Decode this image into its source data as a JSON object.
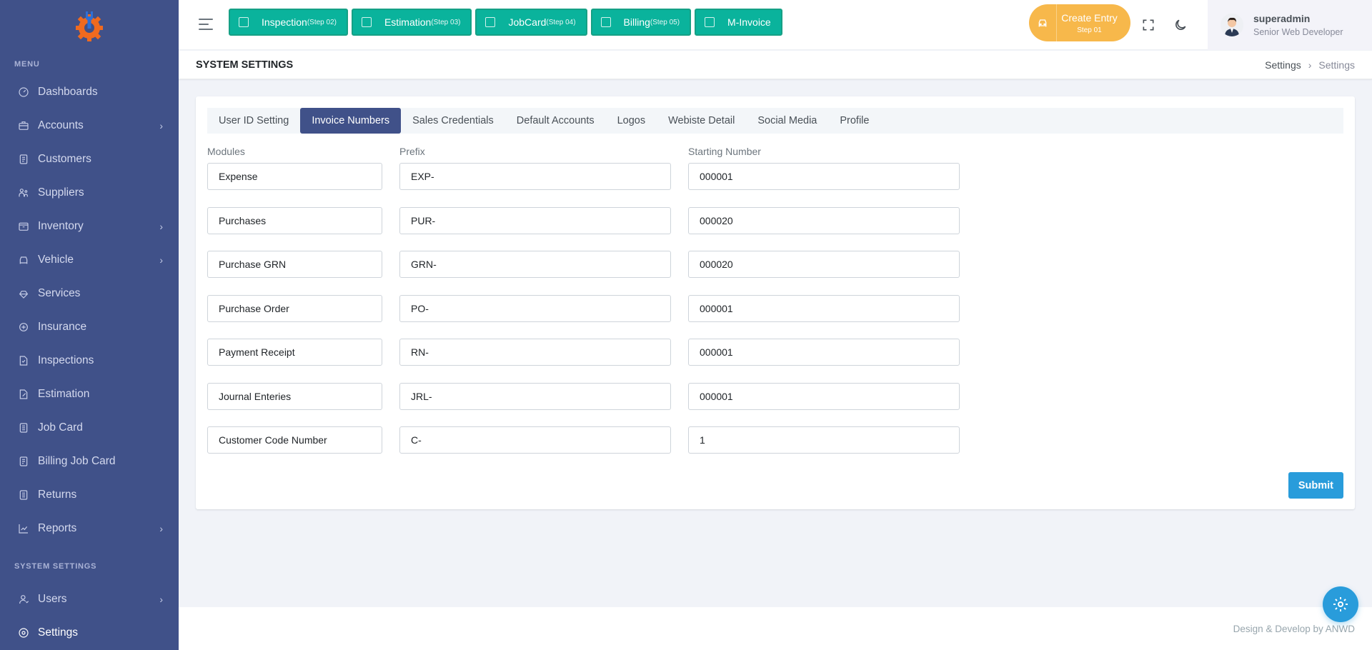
{
  "sidebar": {
    "menu_title": "MENU",
    "items": [
      {
        "label": "Dashboards",
        "icon": "dashboard-icon",
        "chevron": false
      },
      {
        "label": "Accounts",
        "icon": "briefcase-icon",
        "chevron": true
      },
      {
        "label": "Customers",
        "icon": "customers-icon",
        "chevron": false
      },
      {
        "label": "Suppliers",
        "icon": "suppliers-icon",
        "chevron": false
      },
      {
        "label": "Inventory",
        "icon": "inventory-icon",
        "chevron": true
      },
      {
        "label": "Vehicle",
        "icon": "car-icon",
        "chevron": true
      },
      {
        "label": "Services",
        "icon": "services-icon",
        "chevron": false
      },
      {
        "label": "Insurance",
        "icon": "insurance-icon",
        "chevron": false
      },
      {
        "label": "Inspections",
        "icon": "inspections-icon",
        "chevron": false
      },
      {
        "label": "Estimation",
        "icon": "estimation-icon",
        "chevron": false
      },
      {
        "label": "Job Card",
        "icon": "jobcard-icon",
        "chevron": false
      },
      {
        "label": "Billing Job Card",
        "icon": "billing-icon",
        "chevron": false
      },
      {
        "label": "Returns",
        "icon": "returns-icon",
        "chevron": false
      },
      {
        "label": "Reports",
        "icon": "reports-icon",
        "chevron": true
      }
    ],
    "system_title": "SYSTEM SETTINGS",
    "system_items": [
      {
        "label": "Users",
        "icon": "user-icon",
        "chevron": true
      },
      {
        "label": "Settings",
        "icon": "settings-icon",
        "chevron": false,
        "active": true
      }
    ]
  },
  "topbar": {
    "steps": [
      {
        "label": "Inspection",
        "step": "(Step 02)"
      },
      {
        "label": "Estimation",
        "step": "(Step 03)"
      },
      {
        "label": "JobCard",
        "step": "(Step 04)"
      },
      {
        "label": "Billing",
        "step": "(Step 05)"
      },
      {
        "label": "M-Invoice",
        "step": ""
      }
    ],
    "create_entry": {
      "title": "Create Entry",
      "step": "Step 01"
    },
    "user": {
      "name": "superadmin",
      "role": "Senior Web Developer"
    }
  },
  "page": {
    "title": "SYSTEM SETTINGS",
    "breadcrumb": [
      "Settings",
      "Settings"
    ]
  },
  "tabs": [
    "User ID Setting",
    "Invoice Numbers",
    "Sales Credentials",
    "Default Accounts",
    "Logos",
    "Webiste Detail",
    "Social Media",
    "Profile"
  ],
  "active_tab": "Invoice Numbers",
  "columns": {
    "modules": "Modules",
    "prefix": "Prefix",
    "starting_number": "Starting Number"
  },
  "rows": [
    {
      "module": "Expense",
      "prefix": "EXP-",
      "start": "000001"
    },
    {
      "module": "Purchases",
      "prefix": "PUR-",
      "start": "000020"
    },
    {
      "module": "Purchase GRN",
      "prefix": "GRN-",
      "start": "000020"
    },
    {
      "module": "Purchase Order",
      "prefix": "PO-",
      "start": "000001"
    },
    {
      "module": "Payment Receipt",
      "prefix": "RN-",
      "start": "000001"
    },
    {
      "module": "Journal Enteries",
      "prefix": "JRL-",
      "start": "000001"
    },
    {
      "module": "Customer Code Number",
      "prefix": "C-",
      "start": "1"
    }
  ],
  "submit_label": "Submit",
  "footer": "Design & Develop by ANWD",
  "colors": {
    "sidebar": "#405189",
    "accent_green": "#0ab39c",
    "warning": "#f7b84b",
    "primary_blue": "#299cdb"
  }
}
